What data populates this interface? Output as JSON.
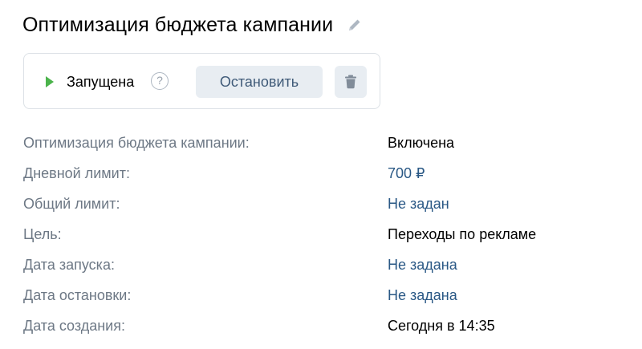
{
  "header": {
    "title": "Оптимизация бюджета кампании",
    "edit_icon": "pencil-icon"
  },
  "status_card": {
    "status_icon": "play-icon",
    "status_color": "#4bb34b",
    "status_label": "Запущена",
    "help_label": "?",
    "stop_label": "Остановить",
    "delete_icon": "trash-icon"
  },
  "details": {
    "rows": [
      {
        "label": "Оптимизация бюджета кампании:",
        "value": "Включена"
      },
      {
        "label": "Дневной лимит:",
        "value": "700 ₽"
      },
      {
        "label": "Общий лимит:",
        "value": "Не задан"
      },
      {
        "label": "Цель:",
        "value": "Переходы по рекламе"
      },
      {
        "label": "Дата запуска:",
        "value": "Не задана"
      },
      {
        "label": "Дата остановки:",
        "value": "Не задана"
      },
      {
        "label": "Дата создания:",
        "value": "Сегодня в 14:35"
      }
    ]
  },
  "colors": {
    "link": "#2a5885",
    "label": "#6d7885",
    "button_bg": "#e8edf2"
  }
}
